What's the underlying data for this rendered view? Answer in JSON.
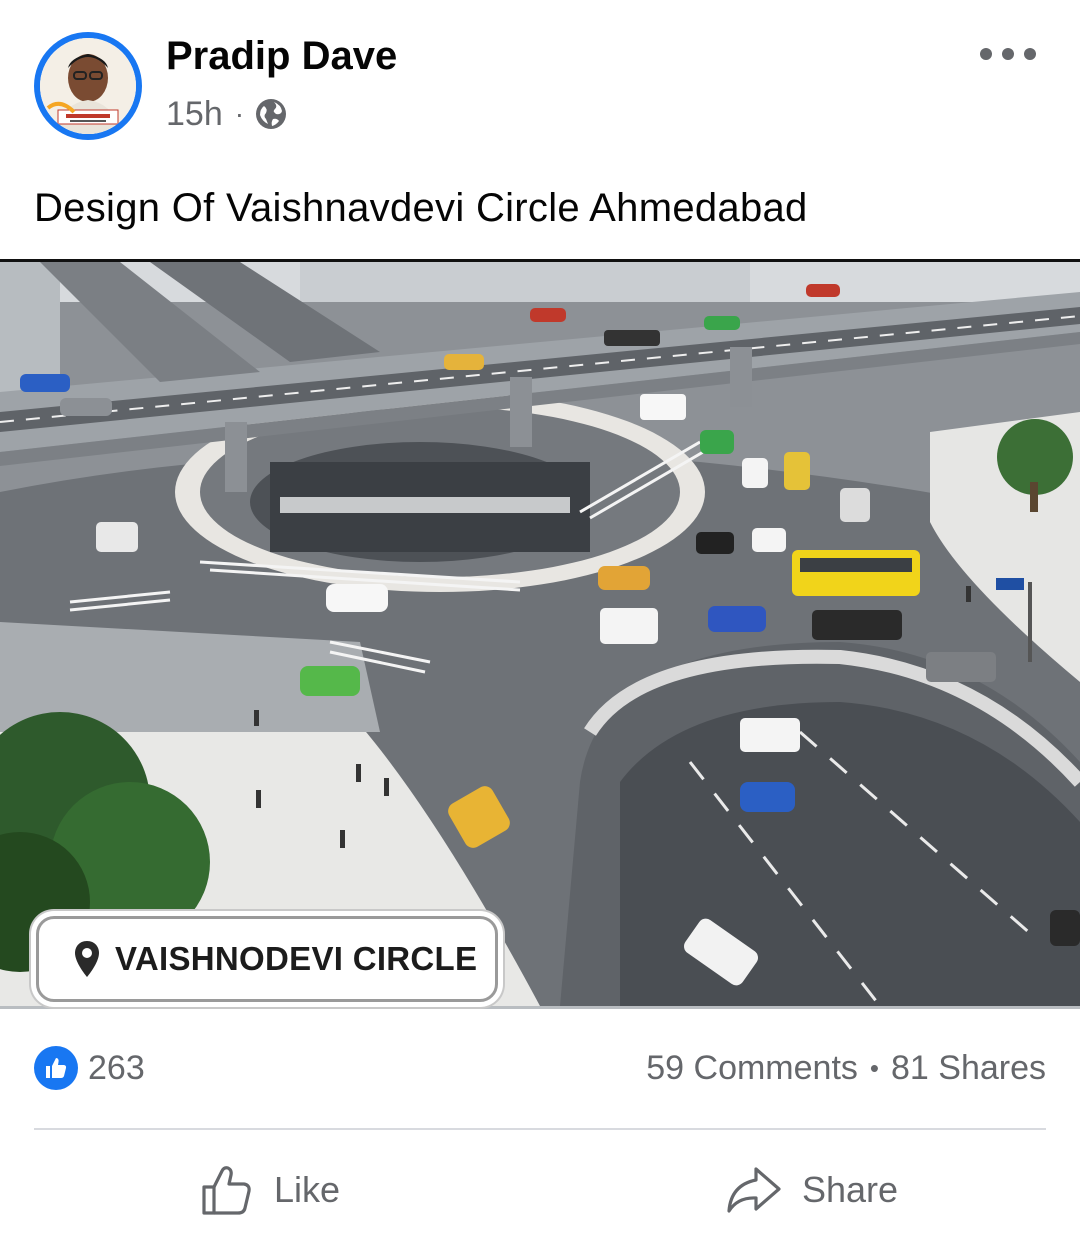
{
  "post": {
    "author": "Pradip Dave",
    "time": "15h",
    "separator": "·",
    "caption": "Design Of Vaishnavdevi Circle Ahmedabad"
  },
  "photo": {
    "location_label": "VAISHNODEVI CIRCLE",
    "location_icon": "map-pin-icon"
  },
  "engagement": {
    "reactions": "263",
    "comments": "59 Comments",
    "separator": "•",
    "shares": "81 Shares"
  },
  "actions": {
    "like_label": "Like",
    "share_label": "Share"
  },
  "colors": {
    "brand": "#1877f2",
    "secondary_text": "#65676b"
  }
}
